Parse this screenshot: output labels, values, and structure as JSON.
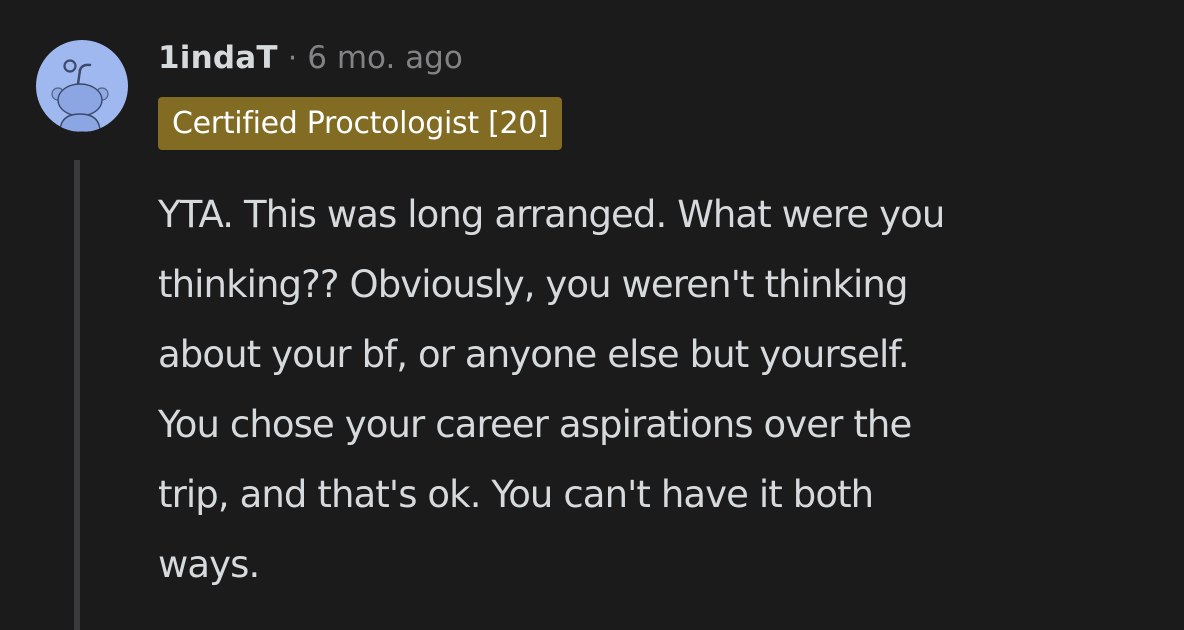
{
  "comment": {
    "author": "1indaT",
    "separator": "·",
    "timestamp": "6 mo. ago",
    "flair": "Certified Proctologist [20]",
    "body": "YTA. This was long arranged. What were you\nthinking?? Obviously, you weren't thinking\nabout your bf, or anyone else but yourself.\nYou chose your career aspirations over the\ntrip, and that's ok. You can't have it both\nways."
  },
  "icons": {
    "avatar": "reddit-snoo-avatar-icon"
  },
  "colors": {
    "background": "#1b1b1b",
    "text": "#d7dadc",
    "muted": "#818384",
    "flair_bg": "#826b23",
    "avatar_bg": "#9fb8f0",
    "thread_line": "#3a3a3c"
  }
}
